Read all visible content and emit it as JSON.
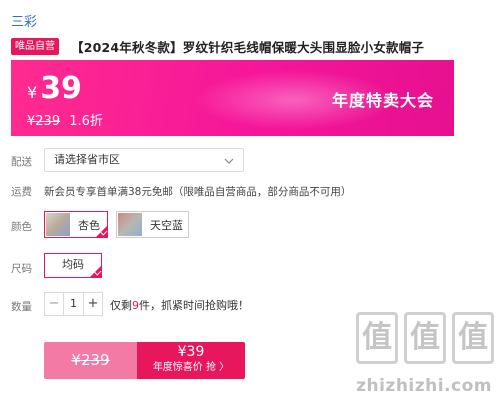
{
  "brand": "三彩",
  "badge": "唯品自营",
  "product_title": "【2024年秋冬款】罗纹针织毛线帽保暖大头围显脸小女款帽子",
  "price": {
    "currency": "¥",
    "current": "39",
    "original": "¥239",
    "discount": "1.6折",
    "slogan": "年度特卖大会"
  },
  "labels": {
    "delivery": "配送",
    "shipping": "运费",
    "color": "颜色",
    "size": "尺码",
    "quantity": "数量"
  },
  "delivery": {
    "placeholder": "请选择省市区"
  },
  "shipping_text": "新会员专享首单满38元免邮（限唯品自营商品，部分商品不可用）",
  "colors": [
    {
      "label": "杏色",
      "selected": true
    },
    {
      "label": "天空蓝",
      "selected": false
    }
  ],
  "size": {
    "label": "均码",
    "selected": true
  },
  "quantity": {
    "minus": "−",
    "value": "1",
    "plus": "+",
    "stock_prefix": "仅剩",
    "stock_count": "9",
    "stock_suffix": "件，抓紧时间抢购哦！"
  },
  "buy": {
    "original_price": "¥239",
    "price": "¥39",
    "label": "年度惊喜价 抢 〉"
  },
  "watermark": {
    "chars": [
      "值",
      "值",
      "值"
    ],
    "site": "zhizhizhi.com"
  },
  "colors_theme": {
    "accent": "#e8175d",
    "link": "#2f6fd6",
    "banner": "#f5169a"
  }
}
